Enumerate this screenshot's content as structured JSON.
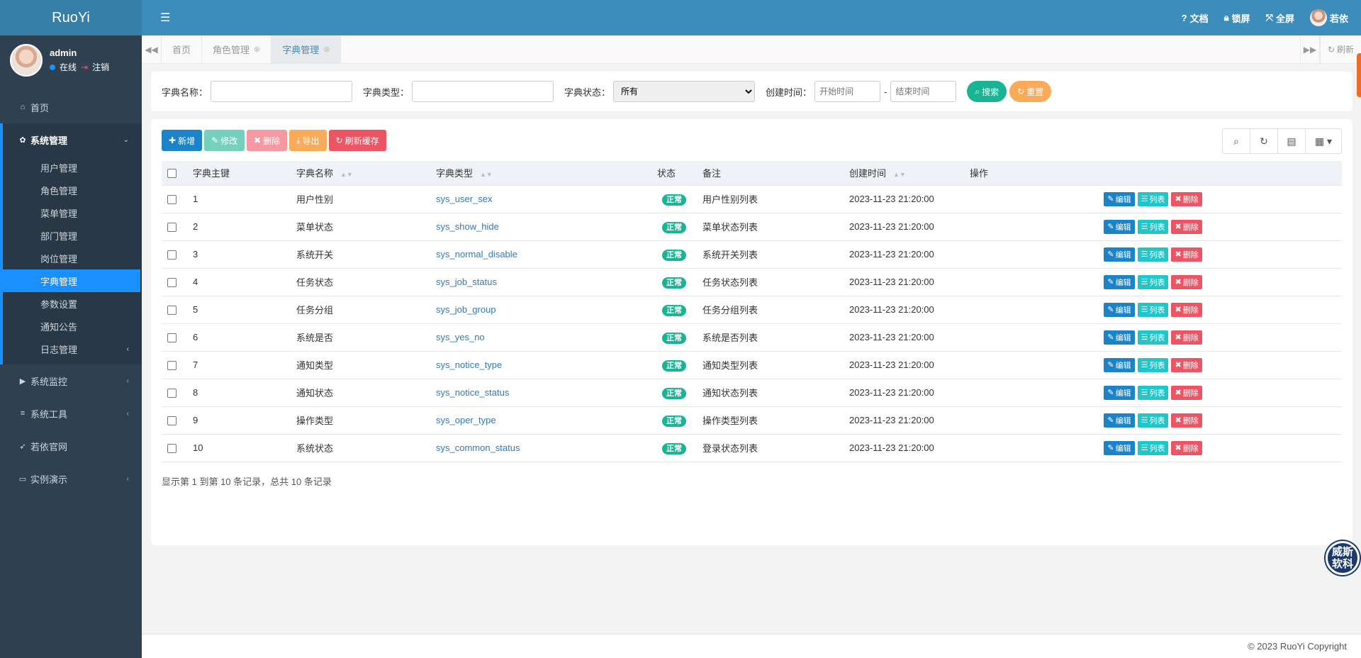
{
  "brand": "RuoYi",
  "user": {
    "name": "admin",
    "online": "在线",
    "logout": "注销"
  },
  "sidebar": {
    "items": [
      {
        "label": "首页",
        "icon": "home-icon"
      },
      {
        "label": "系统管理",
        "icon": "gear-icon",
        "expanded": true,
        "children": [
          "用户管理",
          "角色管理",
          "菜单管理",
          "部门管理",
          "岗位管理",
          "字典管理",
          "参数设置",
          "通知公告",
          "日志管理"
        ],
        "active_child": "字典管理"
      },
      {
        "label": "系统监控",
        "icon": "video-icon"
      },
      {
        "label": "系统工具",
        "icon": "bars-icon"
      },
      {
        "label": "若依官网",
        "icon": "send-icon"
      },
      {
        "label": "实例演示",
        "icon": "desktop-icon"
      }
    ]
  },
  "topbar": {
    "doc": "文档",
    "lock": "锁屏",
    "fullscreen": "全屏",
    "username": "若依"
  },
  "tabs": {
    "items": [
      "首页",
      "角色管理",
      "字典管理"
    ],
    "active": "字典管理",
    "refresh": "刷新"
  },
  "search": {
    "dict_name_label": "字典名称：",
    "dict_type_label": "字典类型：",
    "dict_status_label": "字典状态：",
    "status_value": "所有",
    "created_label": "创建时间：",
    "start_placeholder": "开始时间",
    "end_placeholder": "结束时间",
    "range_sep": "-",
    "search_btn": "搜索",
    "reset_btn": "重置"
  },
  "toolbar": {
    "add": "新增",
    "edit": "修改",
    "delete": "删除",
    "export": "导出",
    "refresh_cache": "刷新缓存"
  },
  "table": {
    "headers": [
      "字典主键",
      "字典名称",
      "字典类型",
      "状态",
      "备注",
      "创建时间",
      "操作"
    ],
    "rows": [
      {
        "id": "1",
        "name": "用户性别",
        "type": "sys_user_sex",
        "status": "正常",
        "remark": "用户性别列表",
        "created": "2023-11-23 21:20:00"
      },
      {
        "id": "2",
        "name": "菜单状态",
        "type": "sys_show_hide",
        "status": "正常",
        "remark": "菜单状态列表",
        "created": "2023-11-23 21:20:00"
      },
      {
        "id": "3",
        "name": "系统开关",
        "type": "sys_normal_disable",
        "status": "正常",
        "remark": "系统开关列表",
        "created": "2023-11-23 21:20:00"
      },
      {
        "id": "4",
        "name": "任务状态",
        "type": "sys_job_status",
        "status": "正常",
        "remark": "任务状态列表",
        "created": "2023-11-23 21:20:00"
      },
      {
        "id": "5",
        "name": "任务分组",
        "type": "sys_job_group",
        "status": "正常",
        "remark": "任务分组列表",
        "created": "2023-11-23 21:20:00"
      },
      {
        "id": "6",
        "name": "系统是否",
        "type": "sys_yes_no",
        "status": "正常",
        "remark": "系统是否列表",
        "created": "2023-11-23 21:20:00"
      },
      {
        "id": "7",
        "name": "通知类型",
        "type": "sys_notice_type",
        "status": "正常",
        "remark": "通知类型列表",
        "created": "2023-11-23 21:20:00"
      },
      {
        "id": "8",
        "name": "通知状态",
        "type": "sys_notice_status",
        "status": "正常",
        "remark": "通知状态列表",
        "created": "2023-11-23 21:20:00"
      },
      {
        "id": "9",
        "name": "操作类型",
        "type": "sys_oper_type",
        "status": "正常",
        "remark": "操作类型列表",
        "created": "2023-11-23 21:20:00"
      },
      {
        "id": "10",
        "name": "系统状态",
        "type": "sys_common_status",
        "status": "正常",
        "remark": "登录状态列表",
        "created": "2023-11-23 21:20:00"
      }
    ],
    "row_actions": {
      "edit": "编辑",
      "list": "列表",
      "delete": "删除"
    }
  },
  "pager": "显示第 1 到第 10 条记录，总共 10 条记录",
  "footer": "© 2023 RuoYi Copyright",
  "float_badge": "威斯软科",
  "colors": {
    "sidebar": "#2f4050",
    "topbar": "#3c8dbc",
    "active": "#1890ff",
    "success": "#1ab394",
    "danger": "#ed5565",
    "warning": "#f8ac59",
    "primary": "#1c84c6",
    "info": "#23c6c8"
  }
}
